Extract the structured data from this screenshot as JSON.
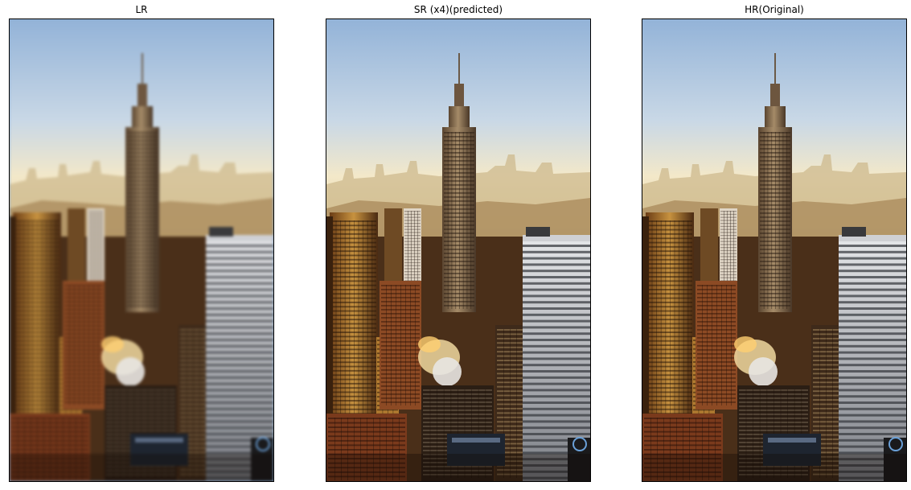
{
  "panels": [
    {
      "title": "LR",
      "blurred": true
    },
    {
      "title": "SR (x4)(predicted)",
      "blurred": false
    },
    {
      "title": "HR(Original)",
      "blurred": false
    }
  ],
  "colors": {
    "sky_top": "#93b3d8",
    "sky_haze": "#f3e8c9",
    "building_shadow": "#2a1a10",
    "building_gold": "#c7923f",
    "white_tower": "#e6e7ea"
  }
}
